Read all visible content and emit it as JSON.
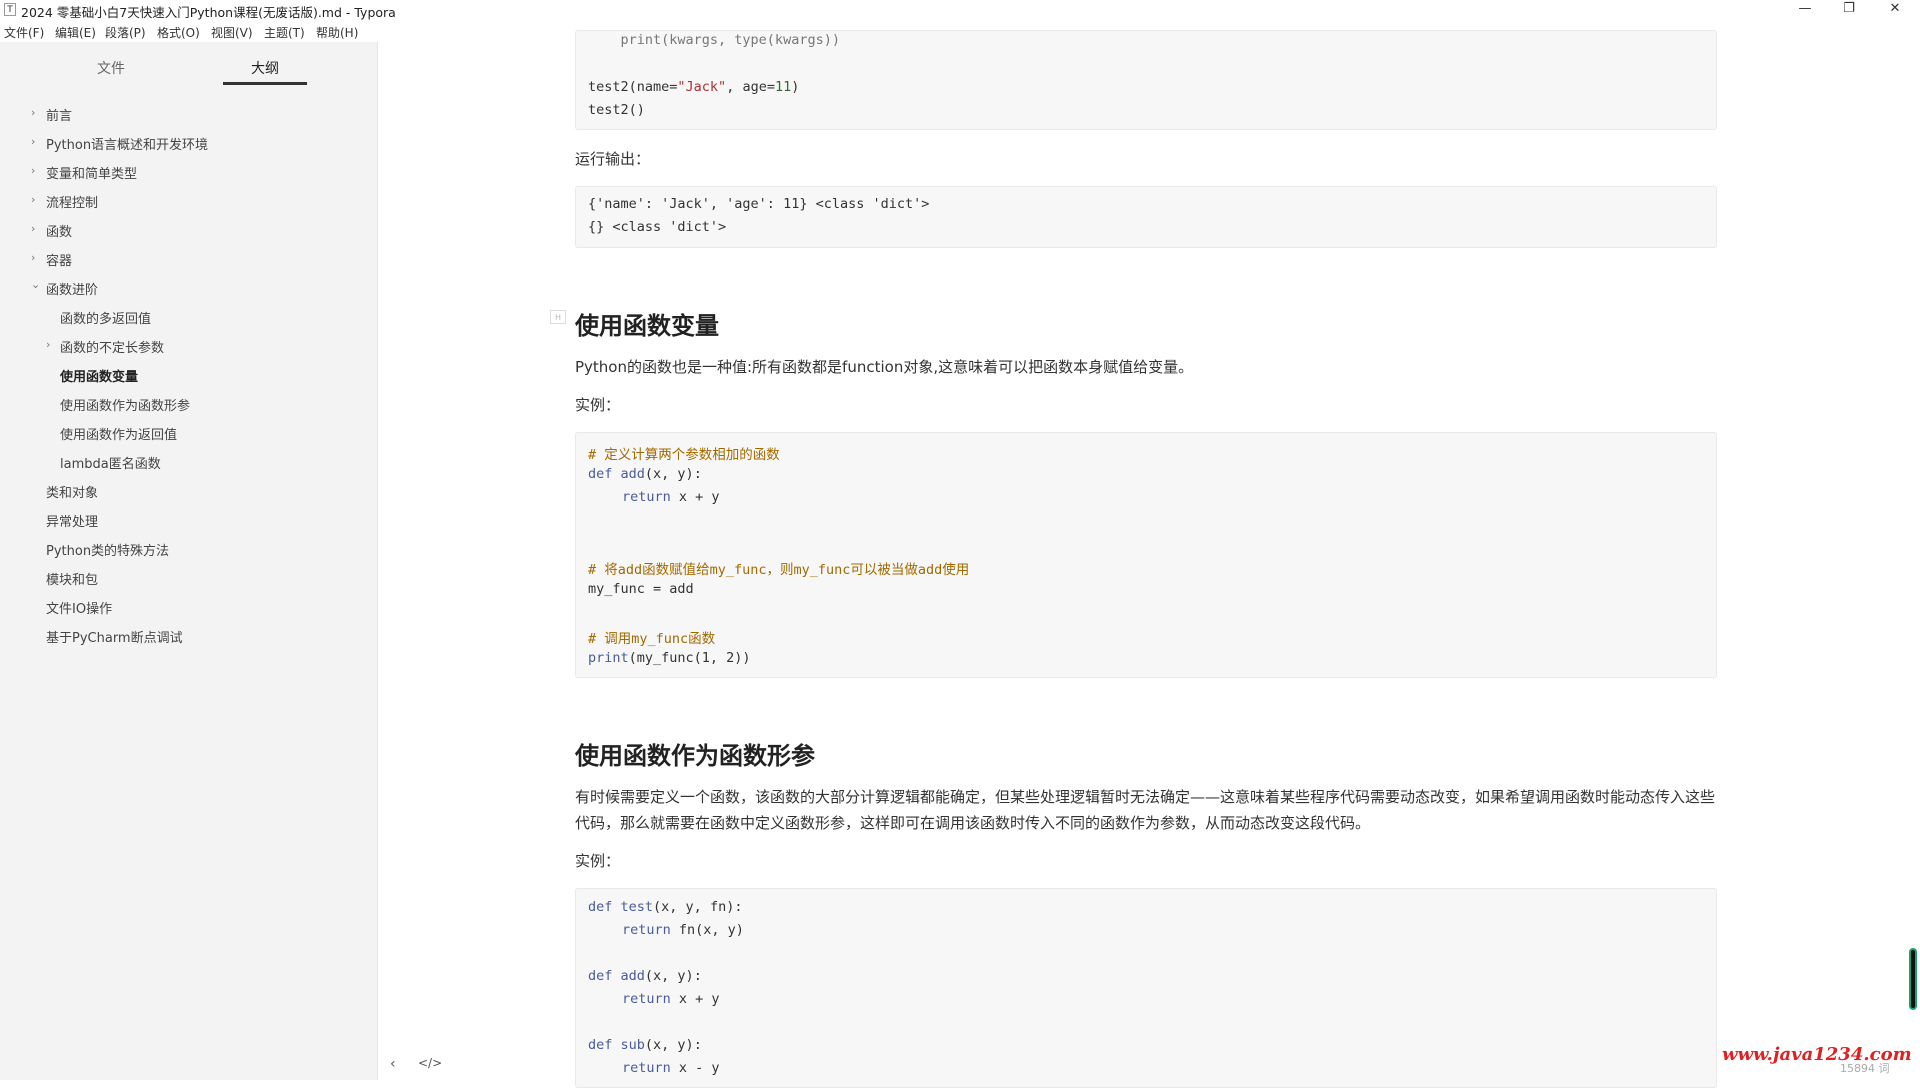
{
  "window": {
    "title": "2024 零基础小白7天快速入门Python课程(无废话版).md - Typora",
    "icon": "T",
    "minimize": "—",
    "restore": "❐",
    "close": "✕"
  },
  "menu": [
    {
      "label": "文件(F)"
    },
    {
      "label": "编辑(E)"
    },
    {
      "label": "段落(P)"
    },
    {
      "label": "格式(O)"
    },
    {
      "label": "视图(V)"
    },
    {
      "label": "主题(T)"
    },
    {
      "label": "帮助(H)"
    }
  ],
  "sidebar": {
    "tabs": [
      {
        "label": "文件"
      },
      {
        "label": "大纲"
      }
    ],
    "outline": [
      {
        "label": "前言",
        "chevron": "›"
      },
      {
        "label": "Python语言概述和开发环境",
        "chevron": "›"
      },
      {
        "label": "变量和简单类型",
        "chevron": "›"
      },
      {
        "label": "流程控制",
        "chevron": "›"
      },
      {
        "label": "函数",
        "chevron": "›"
      },
      {
        "label": "容器",
        "chevron": "›"
      },
      {
        "label": "函数进阶",
        "chevron": "⌄"
      },
      {
        "label": "函数的多返回值",
        "chevron": ""
      },
      {
        "label": "函数的不定长参数",
        "chevron": "›"
      },
      {
        "label": "使用函数变量",
        "chevron": ""
      },
      {
        "label": "使用函数作为函数形参",
        "chevron": ""
      },
      {
        "label": "使用函数作为返回值",
        "chevron": ""
      },
      {
        "label": "lambda匿名函数",
        "chevron": ""
      },
      {
        "label": "类和对象",
        "chevron": ""
      },
      {
        "label": "异常处理",
        "chevron": ""
      },
      {
        "label": "Python类的特殊方法",
        "chevron": ""
      },
      {
        "label": "模块和包",
        "chevron": ""
      },
      {
        "label": "文件IO操作",
        "chevron": ""
      },
      {
        "label": "基于PyCharm断点调试",
        "chevron": ""
      }
    ],
    "footer": {
      "back": "‹",
      "source": "</>"
    }
  },
  "doc": {
    "code1": {
      "line0": "    print(kwargs, type(kwargs))",
      "line1a": "test2(name=",
      "line1b": "\"Jack\"",
      "line1c": ", age=",
      "line1d": "11",
      "line1e": ")",
      "line2": "test2()"
    },
    "output_label": "运行输出：",
    "output": {
      "line1": "{'name': 'Jack', 'age': 11} <class 'dict'>",
      "line2": "{} <class 'dict'>"
    },
    "heading1": "使用函数变量",
    "para1": "Python的函数也是一种值:所有函数都是function对象,这意味着可以把函数本身赋值给变量。",
    "example_label1": "实例：",
    "code2": {
      "c1": "# 定义计算两个参数相加的函数",
      "def": "def",
      "fn_add": "add",
      "sig_add": "(x, y):",
      "ret": "return",
      "ret_add": " x + y",
      "c2": "# 将add函数赋值给my_func，则my_func可以被当做add使用",
      "assign": "my_func = add",
      "c3": "# 调用my_func函数",
      "print": "print",
      "call": "(my_func(1, 2))"
    },
    "heading2": "使用函数作为函数形参",
    "para2": "有时候需要定义一个函数，该函数的大部分计算逻辑都能确定，但某些处理逻辑暂时无法确定——这意味着某些程序代码需要动态改变，如果希望调用函数时能动态传入这些代码，那么就需要在函数中定义函数形参，这样即可在调用该函数时传入不同的函数作为参数，从而动态改变这段代码。",
    "example_label2": "实例：",
    "code3": {
      "def": "def",
      "fn_test": "test",
      "sig_test": "(x, y, fn):",
      "ret": "return",
      "ret_test": " fn(x, y)",
      "fn_add": "add",
      "sig_add": "(x, y):",
      "ret_add": " x + y",
      "fn_sub": "sub",
      "sig_sub": "(x, y):",
      "ret_sub": " x - y"
    }
  },
  "watermark": "www.java1234.com",
  "wordcount": "15894 词"
}
